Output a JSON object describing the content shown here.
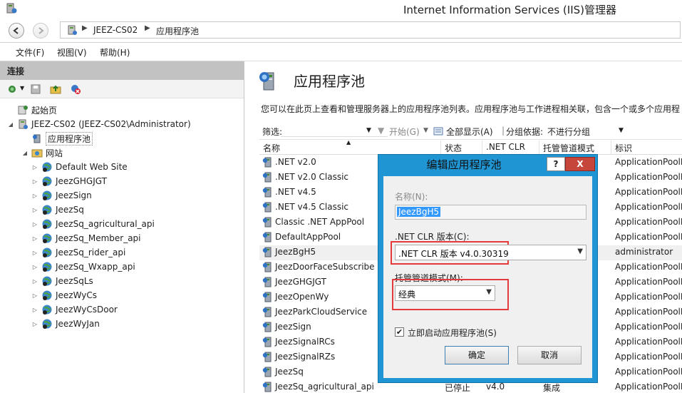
{
  "window": {
    "title": "Internet Information Services (IIS)管理器"
  },
  "address": {
    "segments": [
      "JEEZ-CS02",
      "应用程序池"
    ]
  },
  "menu": [
    "文件(F)",
    "视图(V)",
    "帮助(H)"
  ],
  "left_pane": {
    "header": "连接",
    "tree": [
      {
        "label": "起始页",
        "level": 1,
        "icon": "start-page-icon",
        "expander": ""
      },
      {
        "label": "JEEZ-CS02 (JEEZ-CS02\\Administrator)",
        "level": 1,
        "icon": "server-icon",
        "expander": "◢"
      },
      {
        "label": "应用程序池",
        "level": 2,
        "icon": "app-pool-icon",
        "expander": "",
        "selected": true
      },
      {
        "label": "网站",
        "level": 2,
        "icon": "sites-folder-icon",
        "expander": "◢"
      },
      {
        "label": "Default Web Site",
        "level": 3,
        "icon": "globe-icon",
        "expander": "▷"
      },
      {
        "label": "JeezGHGJGT",
        "level": 3,
        "icon": "globe-icon",
        "expander": "▷"
      },
      {
        "label": "JeezSign",
        "level": 3,
        "icon": "globe-icon",
        "expander": "▷"
      },
      {
        "label": "JeezSq",
        "level": 3,
        "icon": "globe-icon",
        "expander": "▷"
      },
      {
        "label": "JeezSq_agricultural_api",
        "level": 3,
        "icon": "globe-icon",
        "expander": "▷"
      },
      {
        "label": "JeezSq_Member_api",
        "level": 3,
        "icon": "globe-icon",
        "expander": "▷"
      },
      {
        "label": "JeezSq_rider_api",
        "level": 3,
        "icon": "globe-icon",
        "expander": "▷"
      },
      {
        "label": "JeezSq_Wxapp_api",
        "level": 3,
        "icon": "globe-icon",
        "expander": "▷"
      },
      {
        "label": "JeezSqLs",
        "level": 3,
        "icon": "globe-icon",
        "expander": "▷"
      },
      {
        "label": "JeezWyCs",
        "level": 3,
        "icon": "globe-icon",
        "expander": "▷"
      },
      {
        "label": "JeezWyCsDoor",
        "level": 3,
        "icon": "globe-icon",
        "expander": "▷"
      },
      {
        "label": "JeezWyJan",
        "level": 3,
        "icon": "globe-icon",
        "expander": "▷"
      }
    ]
  },
  "main": {
    "title": "应用程序池",
    "description": "您可以在此页上查看和管理服务器上的应用程序池列表。应用程序池与工作进程相关联，包含一个或多个应用程",
    "filter": {
      "label": "筛选:",
      "start": "开始(G)",
      "show_all": "全部显示(A)",
      "group_by_label": "分组依据:",
      "group_by_value": "不进行分组"
    },
    "columns": [
      "名称",
      "状态",
      ".NET CLR ...",
      "托管管道模式",
      "标识"
    ],
    "rows": [
      {
        "name": ".NET v2.0",
        "status": "",
        "clr": "",
        "mode": "",
        "identity": "ApplicationPoolI"
      },
      {
        "name": ".NET v2.0 Classic",
        "status": "",
        "clr": "",
        "mode": "",
        "identity": "ApplicationPoolI"
      },
      {
        "name": ".NET v4.5",
        "status": "",
        "clr": "",
        "mode": "",
        "identity": "ApplicationPoolI"
      },
      {
        "name": ".NET v4.5 Classic",
        "status": "",
        "clr": "",
        "mode": "",
        "identity": "ApplicationPoolI"
      },
      {
        "name": "Classic .NET AppPool",
        "status": "",
        "clr": "",
        "mode": "",
        "identity": "ApplicationPoolI"
      },
      {
        "name": "DefaultAppPool",
        "status": "",
        "clr": "",
        "mode": "",
        "identity": "ApplicationPoolI"
      },
      {
        "name": "JeezBgH5",
        "status": "",
        "clr": "",
        "mode": "",
        "identity": "administrator",
        "selected": true
      },
      {
        "name": "JeezDoorFaceSubscribe",
        "status": "",
        "clr": "",
        "mode": "",
        "identity": "ApplicationPoolI"
      },
      {
        "name": "JeezGHGJGT",
        "status": "",
        "clr": "",
        "mode": "",
        "identity": "ApplicationPoolI"
      },
      {
        "name": "JeezOpenWy",
        "status": "",
        "clr": "",
        "mode": "",
        "identity": "ApplicationPoolI"
      },
      {
        "name": "JeezParkCloudService",
        "status": "",
        "clr": "",
        "mode": "",
        "identity": "ApplicationPoolI"
      },
      {
        "name": "JeezSign",
        "status": "",
        "clr": "",
        "mode": "",
        "identity": "ApplicationPoolI"
      },
      {
        "name": "JeezSignalRCs",
        "status": "",
        "clr": "",
        "mode": "",
        "identity": "ApplicationPoolI"
      },
      {
        "name": "JeezSignalRZs",
        "status": "",
        "clr": "",
        "mode": "",
        "identity": "ApplicationPoolI"
      },
      {
        "name": "JeezSq",
        "status": "",
        "clr": "",
        "mode": "",
        "identity": "ApplicationPoolI"
      },
      {
        "name": "JeezSq_agricultural_api",
        "status": "已停止",
        "clr": "v4.0",
        "mode": "集成",
        "identity": "ApplicationPoolI"
      }
    ]
  },
  "dialog": {
    "title": "编辑应用程序池",
    "help": "?",
    "close": "X",
    "name_label": "名称(N):",
    "name_value": "JeezBgH5",
    "clr_label": ".NET CLR 版本(C):",
    "clr_value": ".NET CLR 版本 v4.0.30319",
    "mode_label": "托管管道模式(M):",
    "mode_value": "经典",
    "autostart_label": "立即启动应用程序池(S)",
    "autostart_checked": "✔",
    "ok": "确定",
    "cancel": "取消"
  }
}
